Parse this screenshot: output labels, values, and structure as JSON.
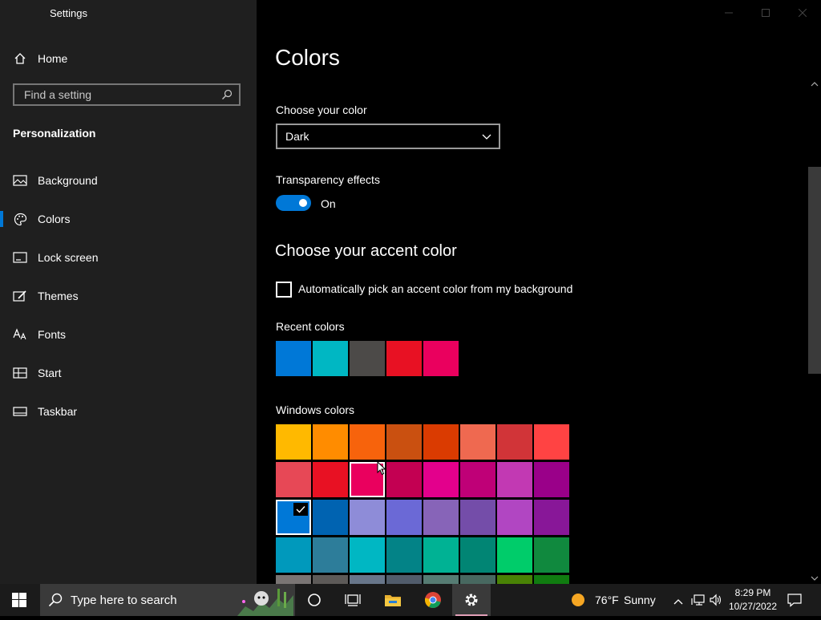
{
  "window": {
    "title": "Settings"
  },
  "sidebar": {
    "home_label": "Home",
    "search_placeholder": "Find a setting",
    "section_title": "Personalization",
    "items": [
      {
        "label": "Background",
        "icon": "picture-icon"
      },
      {
        "label": "Colors",
        "icon": "palette-icon",
        "active": true
      },
      {
        "label": "Lock screen",
        "icon": "lock-screen-icon"
      },
      {
        "label": "Themes",
        "icon": "themes-icon"
      },
      {
        "label": "Fonts",
        "icon": "fonts-icon"
      },
      {
        "label": "Start",
        "icon": "start-icon"
      },
      {
        "label": "Taskbar",
        "icon": "taskbar-icon"
      }
    ]
  },
  "main": {
    "title": "Colors",
    "choose_color_label": "Choose your color",
    "choose_color_value": "Dark",
    "transparency_label": "Transparency effects",
    "transparency_state": "On",
    "accent_heading": "Choose your accent color",
    "auto_pick_label": "Automatically pick an accent color from my background",
    "recent_label": "Recent colors",
    "recent_colors": [
      "#0078d7",
      "#00b7c3",
      "#4c4a48",
      "#e81123",
      "#ea005e"
    ],
    "windows_label": "Windows colors",
    "windows_colors": [
      [
        "#ffb900",
        "#ff8c00",
        "#f7630c",
        "#ca5010",
        "#da3b01",
        "#ef6950",
        "#d13438",
        "#ff4343"
      ],
      [
        "#e74856",
        "#e81123",
        "#ea005e",
        "#c30052",
        "#e3008c",
        "#bf0077",
        "#c239b3",
        "#9a0089"
      ],
      [
        "#0078d7",
        "#0063b1",
        "#8e8cd8",
        "#6b69d6",
        "#8764b8",
        "#744da9",
        "#b146c2",
        "#881798"
      ],
      [
        "#0099bc",
        "#2d7d9a",
        "#00b7c3",
        "#038387",
        "#00b294",
        "#018574",
        "#00cc6a",
        "#10893e"
      ],
      [
        "#7a7574",
        "#5d5a58",
        "#68768a",
        "#515c6b",
        "#567c73",
        "#486860",
        "#498205",
        "#107c10"
      ]
    ],
    "selected_color": [
      2,
      0
    ],
    "hovered_color": [
      1,
      2
    ]
  },
  "taskbar": {
    "search_placeholder": "Type here to search",
    "weather_temp": "76°F",
    "weather_cond": "Sunny",
    "time": "8:29 PM",
    "date": "10/27/2022"
  },
  "colors": {
    "accent": "#0078d7",
    "sidebar_bg": "#1f1f1f",
    "main_bg": "#000000"
  }
}
